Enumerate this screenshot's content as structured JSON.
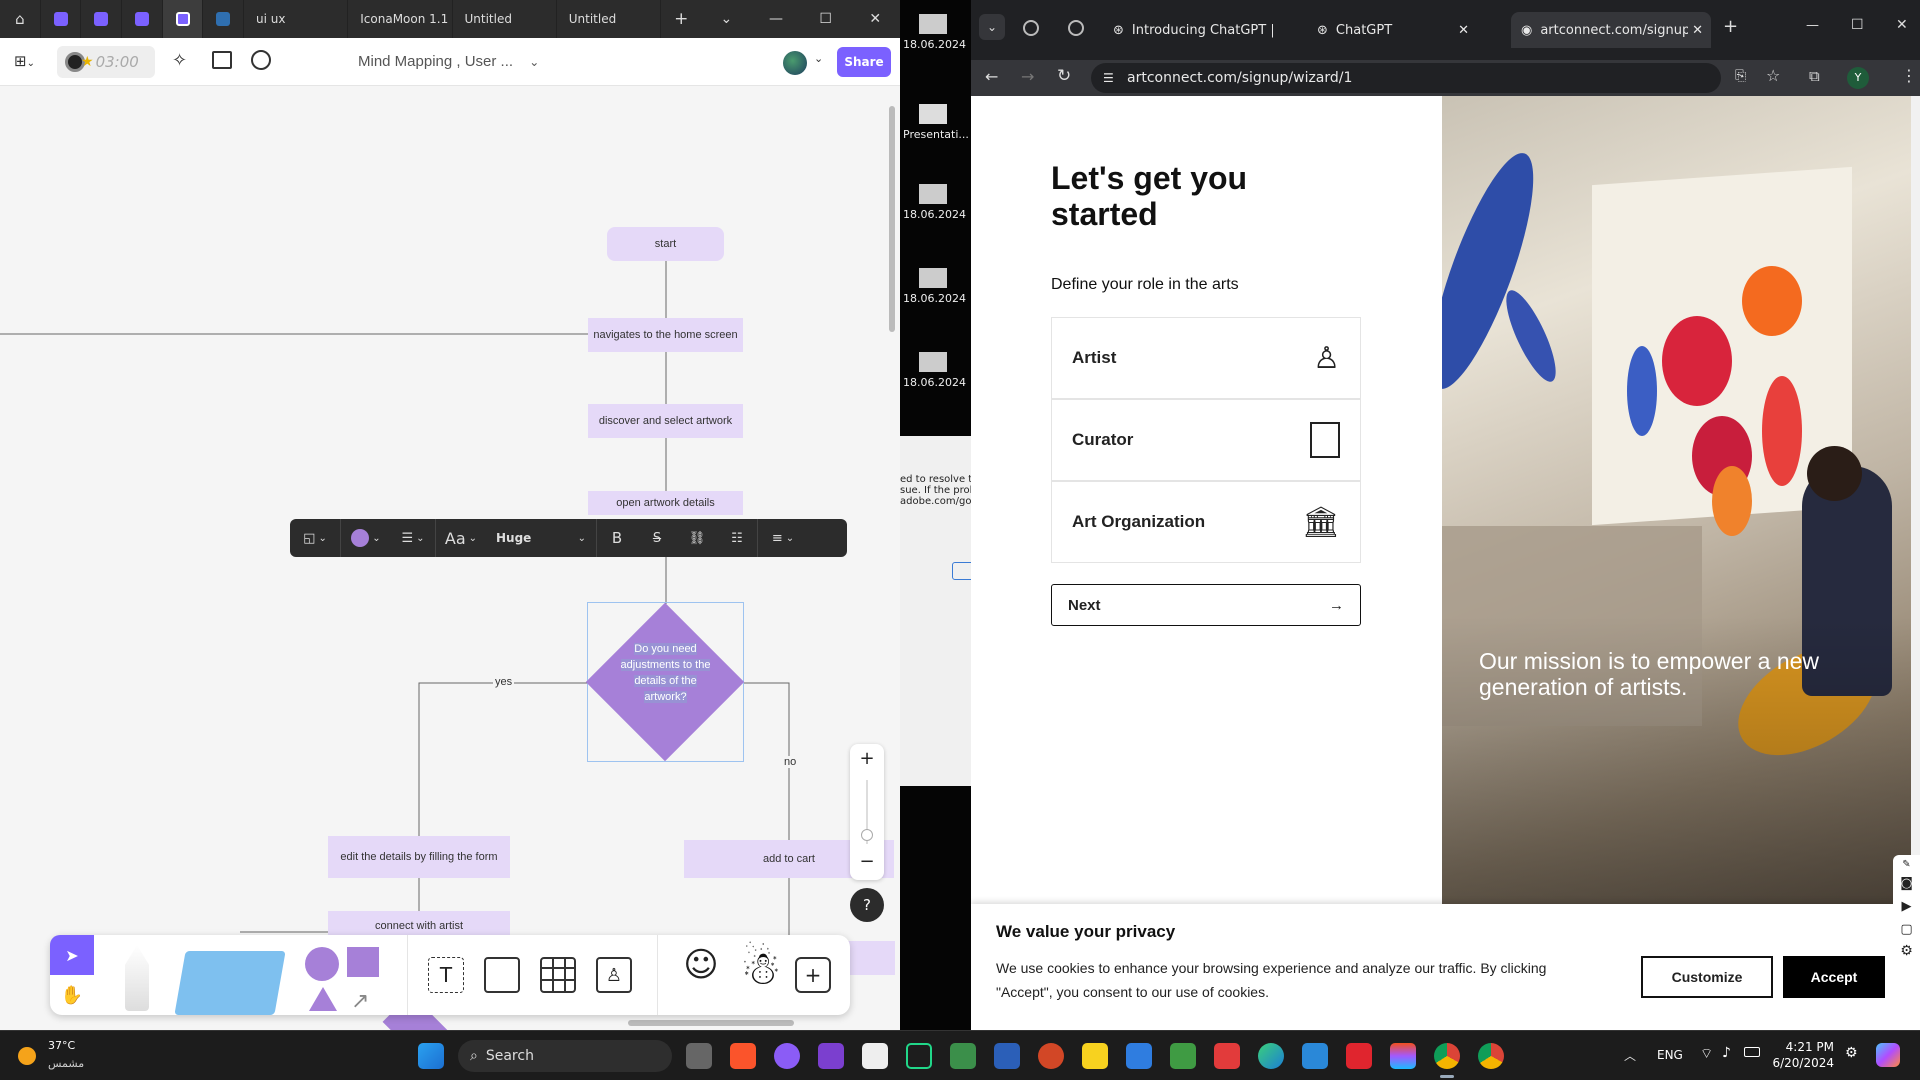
{
  "figjam": {
    "tabs": [
      {
        "label": ""
      },
      {
        "label": ""
      },
      {
        "label": ""
      },
      {
        "label": ""
      },
      {
        "label": ""
      },
      {
        "label": "ui ux"
      },
      {
        "label": "IconaMoon 1.1"
      },
      {
        "label": "Untitled"
      },
      {
        "label": "Untitled"
      }
    ],
    "timer": "03:00",
    "file_title": "Mind Mapping , User ...",
    "share_label": "Share",
    "nodes": {
      "start": "start",
      "home": "navigates to the home screen",
      "discover": "discover and select artwork",
      "open_details": "open artwork details",
      "decision": "Do you need adjustments to the details of the artwork?",
      "edit": "edit the details by filling the form",
      "connect": "connect with artist",
      "add_cart": "add to cart"
    },
    "edge_labels": {
      "yes": "yes",
      "no": "no"
    },
    "format_bar": {
      "text_icon": "Aa",
      "size": "Huge",
      "bold": "B"
    },
    "zoom": {
      "plus": "+",
      "minus": "−"
    },
    "help": "?"
  },
  "desktop": {
    "icons": [
      {
        "label": "18.06.2024"
      },
      {
        "label": "Presentati..."
      },
      {
        "label": "18.06.2024"
      },
      {
        "label": "18.06.2024"
      },
      {
        "label": "18.06.2024"
      }
    ],
    "dialog_lines": [
      "ed to resolve th",
      "sue. If the prob",
      "adobe.com/go/"
    ]
  },
  "chrome": {
    "tabs": [
      {
        "label": "Introducing ChatGPT | O"
      },
      {
        "label": "ChatGPT"
      },
      {
        "label": "artconnect.com/signup/"
      }
    ],
    "url": "artconnect.com/signup/wizard/1",
    "profile": "Y"
  },
  "signup": {
    "heading": "Let's get you started",
    "subheading": "Define your role in the arts",
    "roles": [
      {
        "label": "Artist"
      },
      {
        "label": "Curator"
      },
      {
        "label": "Art Organization"
      }
    ],
    "next_label": "Next",
    "mission": "Our mission is to empower a new generation of artists."
  },
  "privacy": {
    "title": "We value your privacy",
    "body": "We use cookies to enhance your browsing experience and analyze our traffic. By clicking \"Accept\", you consent to our use of cookies.",
    "customize": "Customize",
    "accept": "Accept"
  },
  "taskbar": {
    "weather_temp": "37°C",
    "weather_text": "مشمس",
    "search_placeholder": "Search",
    "lang": "ENG",
    "time": "4:21 PM",
    "date": "6/20/2024"
  },
  "colors": {
    "figjam_purple": "#7b61ff",
    "node_fill": "#e5d9f8",
    "diamond_fill": "#a680d8",
    "accept_bg": "#000000"
  }
}
